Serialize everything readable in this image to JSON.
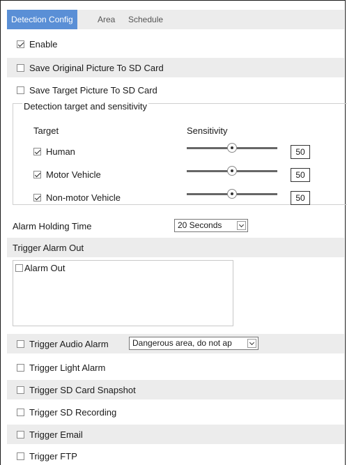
{
  "tabs": [
    "Detection Config",
    "Area",
    "Schedule"
  ],
  "enable": {
    "label": "Enable",
    "checked": true
  },
  "save_original": {
    "label": "Save Original Picture To SD Card",
    "checked": false
  },
  "save_target": {
    "label": "Save Target Picture To SD Card",
    "checked": false
  },
  "detection": {
    "legend": "Detection target and sensitivity",
    "col_target": "Target",
    "col_sensitivity": "Sensitivity",
    "targets": [
      {
        "label": "Human",
        "checked": true,
        "value": "50"
      },
      {
        "label": "Motor Vehicle",
        "checked": true,
        "value": "50"
      },
      {
        "label": "Non-motor Vehicle",
        "checked": true,
        "value": "50"
      }
    ]
  },
  "alarm_holding": {
    "label": "Alarm Holding Time",
    "value": "20 Seconds"
  },
  "trigger_alarm_out": {
    "label": "Trigger Alarm Out",
    "option": "Alarm Out",
    "checked": false
  },
  "audio_alarm": {
    "label": "Trigger Audio Alarm",
    "value": "Dangerous area, do not ap",
    "checked": false
  },
  "light_alarm": {
    "label": "Trigger Light Alarm",
    "checked": false
  },
  "sd_snapshot": {
    "label": "Trigger SD Card Snapshot",
    "checked": false
  },
  "sd_recording": {
    "label": "Trigger SD Recording",
    "checked": false
  },
  "email": {
    "label": "Trigger Email",
    "checked": false
  },
  "ftp": {
    "label": "Trigger FTP",
    "checked": false
  }
}
